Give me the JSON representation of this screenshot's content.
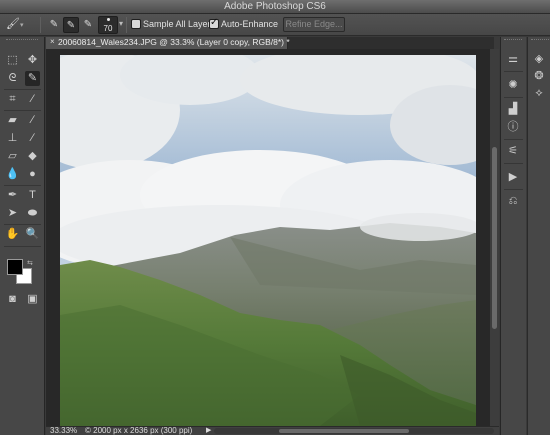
{
  "window": {
    "title": "Adobe Photoshop CS6"
  },
  "options_bar": {
    "tool_preset_icon": "quick-selection-brush-icon",
    "modes": [
      {
        "icon": "new-selection-brush-icon",
        "active": false
      },
      {
        "icon": "add-to-selection-brush-icon",
        "active": true
      },
      {
        "icon": "subtract-from-selection-brush-icon",
        "active": false
      }
    ],
    "brush_size": "70",
    "sample_all_layers": {
      "label": "Sample All Layers",
      "checked": false
    },
    "auto_enhance": {
      "label": "Auto-Enhance",
      "checked": true
    },
    "refine_edge_label": "Refine Edge..."
  },
  "document_tab": {
    "close_glyph": "×",
    "title": "20060814_Wales234.JPG @ 33.3% (Layer 0 copy, RGB/8*) *"
  },
  "status_bar": {
    "zoom": "33.33%",
    "doc_info": "2000 px x 2636 px (300 ppi)"
  },
  "colors": {
    "foreground": "#000000",
    "background": "#ffffff",
    "ui_bg": "#474747"
  }
}
